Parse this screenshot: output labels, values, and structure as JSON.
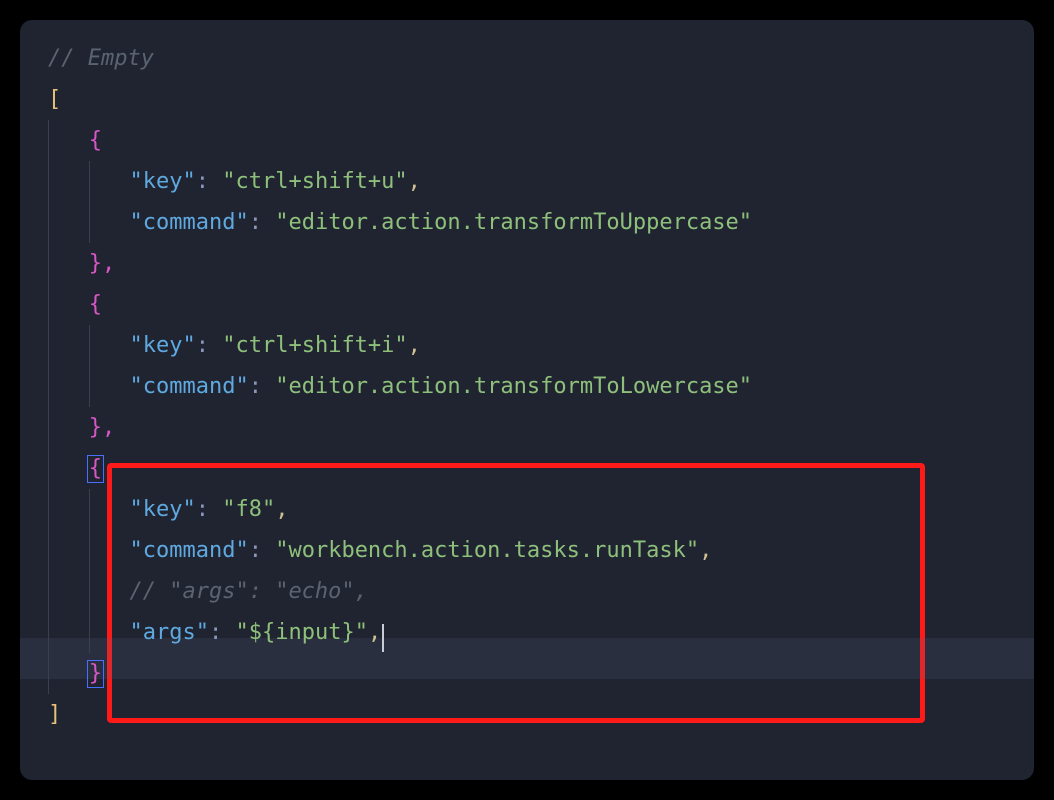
{
  "code": {
    "comment_top": "// Empty",
    "open_array": "[",
    "close_array": "]",
    "open_brace": "{",
    "close_brace": "}",
    "close_brace_comma": "},",
    "entries": [
      {
        "key_label": "\"key\"",
        "key_value": "\"ctrl+shift+u\"",
        "cmd_label": "\"command\"",
        "cmd_value": "\"editor.action.transformToUppercase\""
      },
      {
        "key_label": "\"key\"",
        "key_value": "\"ctrl+shift+i\"",
        "cmd_label": "\"command\"",
        "cmd_value": "\"editor.action.transformToLowercase\""
      },
      {
        "key_label": "\"key\"",
        "key_value": "\"f8\"",
        "cmd_label": "\"command\"",
        "cmd_value": "\"workbench.action.tasks.runTask\"",
        "args_comment": "// \"args\": \"echo\",",
        "args_label": "\"args\"",
        "args_value": "\"${input}\""
      }
    ],
    "colon_sep": ": ",
    "comma": ","
  }
}
